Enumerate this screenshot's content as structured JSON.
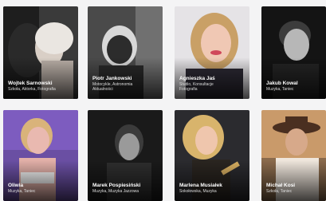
{
  "cards": [
    {
      "name": "Wojtek Sarnowski",
      "meta": "Szkoła, Aktorka, Fotografia"
    },
    {
      "name": "Piotr Jankowski",
      "meta": "Motocykle, Astronomia",
      "meta2": "Aktualności"
    },
    {
      "name": "Agnieszka Jaś",
      "meta": "Studio, Konsultacje",
      "meta2": "Fotografia"
    },
    {
      "name": "Jakub Kowal",
      "meta": "Muzyka, Taniec"
    },
    {
      "name": "Oliwia",
      "meta": "Muzyka, Taniec"
    },
    {
      "name": "Marek Pospiesiński",
      "meta": "Muzyka, Muzyka Jazzowa"
    },
    {
      "name": "Marlena Musiałek",
      "meta": "Sokołowska, Muzyka"
    },
    {
      "name": "Michał Kosi",
      "meta": "Szkoła, Taniec"
    }
  ],
  "colors": {
    "background": "#f4f4f5",
    "caption_text": "#ffffff"
  }
}
